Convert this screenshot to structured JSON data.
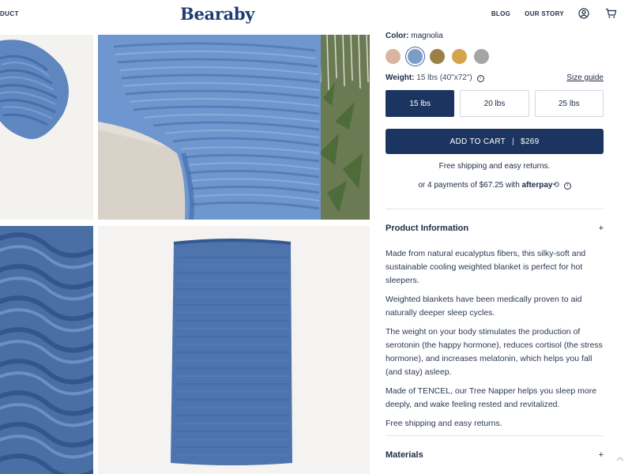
{
  "header": {
    "nav_left": "DUCT",
    "logo": "Bearaby",
    "nav_right": [
      "BLOG",
      "OUR STORY"
    ],
    "account_icon": "account-icon",
    "cart_icon": "cart-icon"
  },
  "gallery": {
    "images": [
      "knit-blanket-rolled",
      "knit-blanket-on-chair",
      "knit-texture-closeup",
      "knit-blanket-flat"
    ]
  },
  "product": {
    "color_label": "Color:",
    "color_value": "magnolia",
    "swatches": [
      {
        "name": "sand",
        "color": "#d8b5a0"
      },
      {
        "name": "blue",
        "color": "#7d9cc8"
      },
      {
        "name": "olive",
        "color": "#9a8048"
      },
      {
        "name": "mustard",
        "color": "#d4a34c"
      },
      {
        "name": "grey",
        "color": "#a3a6a4"
      }
    ],
    "weight_label": "Weight:",
    "weight_value": "15 lbs (40\"x72\")",
    "size_guide": "Size guide",
    "weights": [
      "15 lbs",
      "20 lbs",
      "25 lbs"
    ],
    "add_to_cart": "ADD TO CART",
    "price": "$269",
    "shipping_note": "Free shipping and easy returns.",
    "payment_prefix": "or 4 payments of $67.25 with",
    "payment_brand": "afterpay",
    "payment_symbol": "⟲"
  },
  "accordion": {
    "product_info_title": "Product Information",
    "product_info_paragraphs": [
      "Made from natural eucalyptus fibers, this silky-soft and sustainable cooling weighted blanket is perfect for hot sleepers.",
      "Weighted blankets have been medically proven to aid naturally deeper sleep cycles.",
      "The weight on your body stimulates the production of serotonin (the happy hormone), reduces cortisol (the stress hormone), and increases melatonin, which helps you fall (and stay) asleep.",
      "Made of TENCEL, our Tree Napper helps you sleep more deeply, and wake feeling rested and revitalized.",
      "Free shipping and easy returns."
    ],
    "materials_title": "Materials",
    "expand_symbol": "+"
  },
  "colors": {
    "brand_navy": "#1b3560",
    "logo_blue": "#1f3d73",
    "text": "#1d2a44",
    "knit_blue": "#5f86bf"
  }
}
